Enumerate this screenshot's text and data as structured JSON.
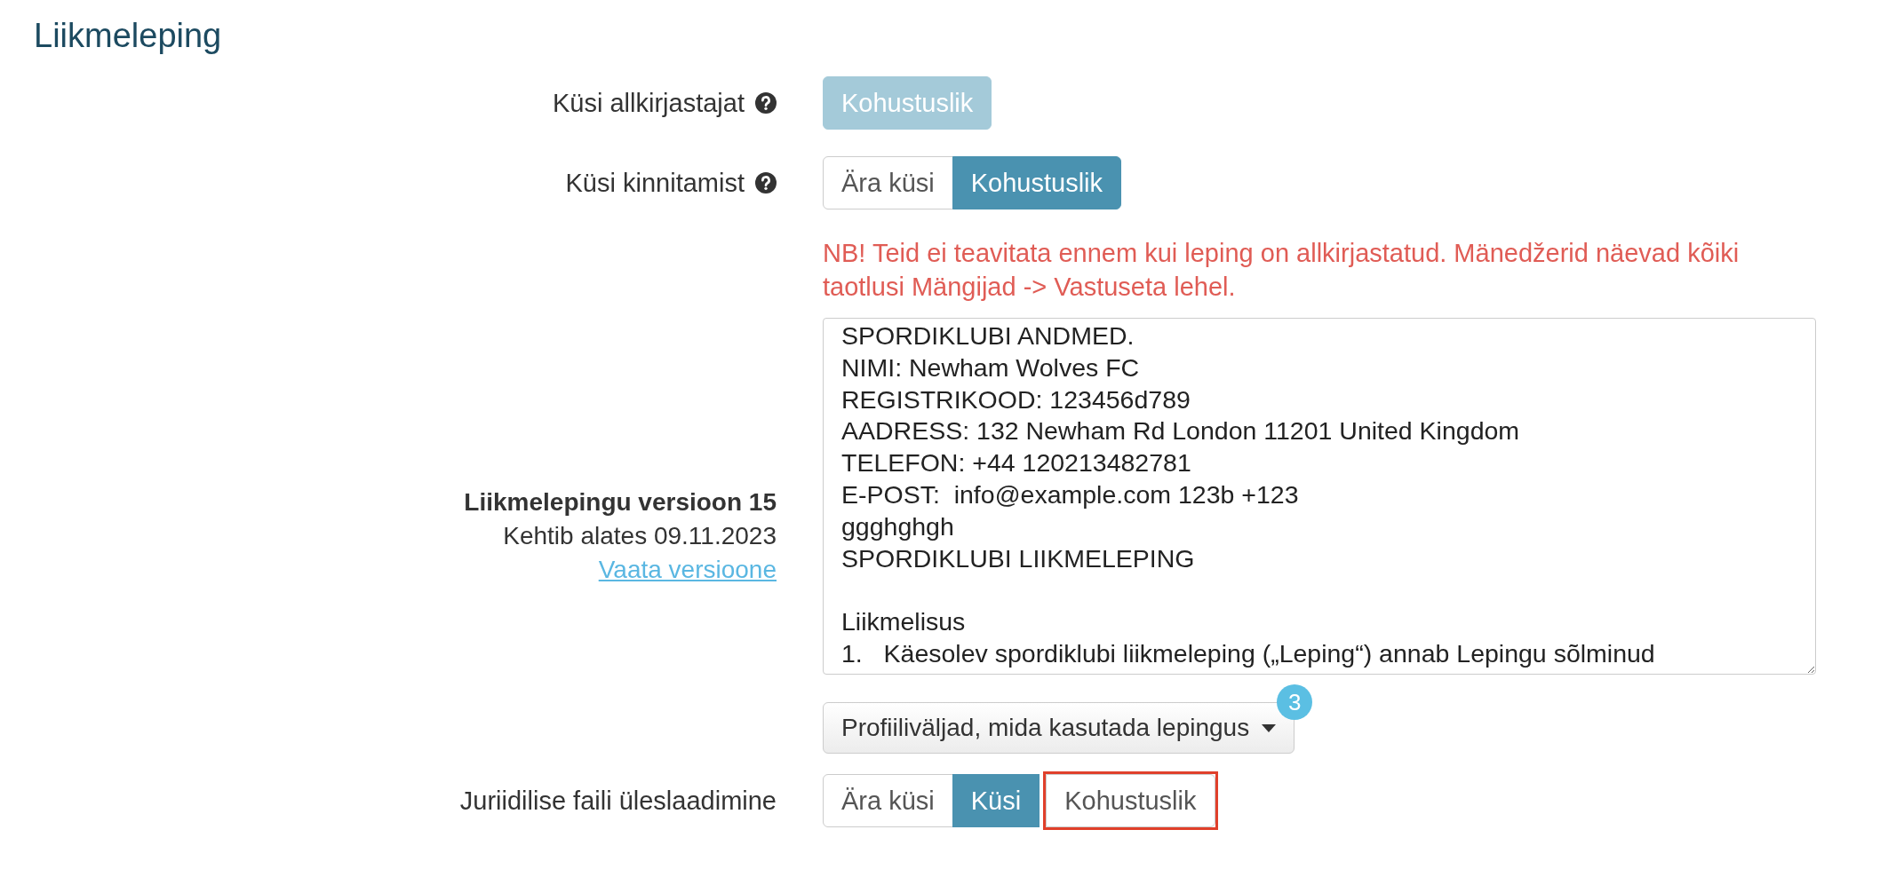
{
  "section": {
    "title": "Liikmeleping"
  },
  "rows": [
    {
      "kind": "toggle",
      "label": "Küsi allkirjastajat",
      "help": true,
      "options": [
        {
          "label": "Kohustuslik",
          "selected": true,
          "disabled": true,
          "highlighted": false
        }
      ]
    },
    {
      "kind": "toggle",
      "label": "Küsi kinnitamist",
      "help": true,
      "options": [
        {
          "label": "Ära küsi",
          "selected": false,
          "disabled": false,
          "highlighted": false
        },
        {
          "label": "Kohustuslik",
          "selected": true,
          "disabled": false,
          "highlighted": false
        }
      ]
    },
    {
      "kind": "notice",
      "text": "NB! Teid ei teavitata ennem kui leping on allkirjastatud. Mänedžerid näevad kõiki taotlusi Mängijad -> Vastuseta lehel."
    },
    {
      "kind": "document",
      "title": "Liikmelepingu versioon 15",
      "valid_from": "Kehtib alates 09.11.2023",
      "link": "Vaata versioone",
      "content": "SPORDIKLUBI ANDMED.\nNIMI: Newham Wolves FC\nREGISTRIKOOD: 123456d789\nAADRESS: 132 Newham Rd London 11201 United Kingdom\nTELEFON: +44 120213482781\nE-POST:  info@example.com 123b +123\nggghghgh\nSPORDIKLUBI LIIKMELEPING\n\nLiikmelisus\n1.\tKäesolev spordiklubi liikmeleping („Leping“) annab Lepingu sõlminud",
      "dropdown": {
        "label": "Profiiliväljad, mida kasutada lepingus",
        "badge": "3"
      }
    },
    {
      "kind": "toggle",
      "label": "Juriidilise faili üleslaadimine",
      "help": false,
      "options": [
        {
          "label": "Ära küsi",
          "selected": false,
          "disabled": false,
          "highlighted": false
        },
        {
          "label": "Küsi",
          "selected": true,
          "disabled": false,
          "highlighted": false
        },
        {
          "label": "Kohustuslik",
          "selected": false,
          "disabled": false,
          "highlighted": true
        }
      ]
    }
  ]
}
